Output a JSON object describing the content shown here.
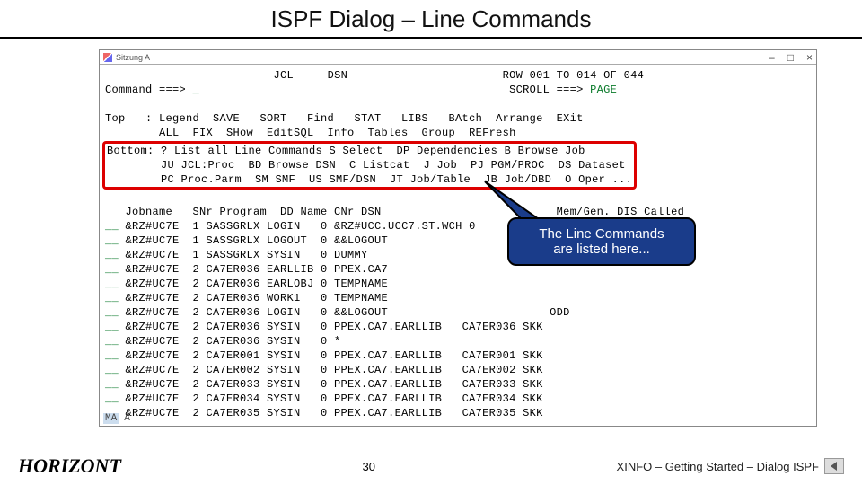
{
  "slide": {
    "title": "ISPF Dialog – Line Commands",
    "brand": "HORIZONT",
    "pagenum": "30",
    "credit": "XINFO – Getting Started – Dialog ISPF"
  },
  "window": {
    "title_label": "Sitzung A",
    "btn_min": "–",
    "btn_max": "□",
    "btn_close": "×"
  },
  "term": {
    "hdr_jcl": "JCL",
    "hdr_dsn": "DSN",
    "row_info": "ROW 001 TO 014 OF 044",
    "scroll_label": "SCROLL ===>",
    "scroll_value": "PAGE",
    "cmd_label": "Command ===>",
    "cmd_cursor": "_",
    "top_line1": "Top   : Legend  SAVE   SORT   Find   STAT   LIBS   BAtch  Arrange  EXit",
    "top_line2": "        ALL  FIX  SHow  EditSQL  Info  Tables  Group  REFresh",
    "bot_line1": "Bottom: ? List all Line Commands S Select  DP Dependencies B Browse Job",
    "bot_line2": "        JU JCL:Proc  BD Browse DSN  C Listcat  J Job  PJ PGM/PROC  DS Dataset",
    "bot_line3": "        PC Proc.Parm  SM SMF  US SMF/DSN  JT Job/Table  JB Job/DBD  O Oper ...",
    "col_header": "   Jobname   SNr Program  DD Name CNr DSN                          Mem/Gen. DIS Called",
    "status_ma": "MA",
    "status_a": "A"
  },
  "rows": [
    {
      "job": "&RZ#UC7E",
      "snr": "1",
      "prog": "SASSGRLX",
      "dd": "LOGIN  ",
      "cnr": "0",
      "dsn": "&RZ#UCC.UCC7.ST.WCH 0           SKK"
    },
    {
      "job": "&RZ#UC7E",
      "snr": "1",
      "prog": "SASSGRLX",
      "dd": "LOGOUT ",
      "cnr": "0",
      "dsn": "&&LOGOUT                        NRR"
    },
    {
      "job": "&RZ#UC7E",
      "snr": "1",
      "prog": "SASSGRLX",
      "dd": "SYSIN  ",
      "cnr": "0",
      "dsn": "DUMMY"
    },
    {
      "job": "&RZ#UC7E",
      "snr": "2",
      "prog": "CA7ER036",
      "dd": "EARLLIB",
      "cnr": "0",
      "dsn": "PPEX.CA7"
    },
    {
      "job": "&RZ#UC7E",
      "snr": "2",
      "prog": "CA7ER036",
      "dd": "EARLOBJ",
      "cnr": "0",
      "dsn": "TEMPNAME"
    },
    {
      "job": "&RZ#UC7E",
      "snr": "2",
      "prog": "CA7ER036",
      "dd": "WORK1  ",
      "cnr": "0",
      "dsn": "TEMPNAME"
    },
    {
      "job": "&RZ#UC7E",
      "snr": "2",
      "prog": "CA7ER036",
      "dd": "LOGIN  ",
      "cnr": "0",
      "dsn": "&&LOGOUT                        ODD"
    },
    {
      "job": "&RZ#UC7E",
      "snr": "2",
      "prog": "CA7ER036",
      "dd": "SYSIN  ",
      "cnr": "0",
      "dsn": "PPEX.CA7.EARLLIB   CA7ER036 SKK"
    },
    {
      "job": "&RZ#UC7E",
      "snr": "2",
      "prog": "CA7ER036",
      "dd": "SYSIN  ",
      "cnr": "0",
      "dsn": "*"
    },
    {
      "job": "&RZ#UC7E",
      "snr": "2",
      "prog": "CA7ER001",
      "dd": "SYSIN  ",
      "cnr": "0",
      "dsn": "PPEX.CA7.EARLLIB   CA7ER001 SKK"
    },
    {
      "job": "&RZ#UC7E",
      "snr": "2",
      "prog": "CA7ER002",
      "dd": "SYSIN  ",
      "cnr": "0",
      "dsn": "PPEX.CA7.EARLLIB   CA7ER002 SKK"
    },
    {
      "job": "&RZ#UC7E",
      "snr": "2",
      "prog": "CA7ER033",
      "dd": "SYSIN  ",
      "cnr": "0",
      "dsn": "PPEX.CA7.EARLLIB   CA7ER033 SKK"
    },
    {
      "job": "&RZ#UC7E",
      "snr": "2",
      "prog": "CA7ER034",
      "dd": "SYSIN  ",
      "cnr": "0",
      "dsn": "PPEX.CA7.EARLLIB   CA7ER034 SKK"
    },
    {
      "job": "&RZ#UC7E",
      "snr": "2",
      "prog": "CA7ER035",
      "dd": "SYSIN  ",
      "cnr": "0",
      "dsn": "PPEX.CA7.EARLLIB   CA7ER035 SKK"
    }
  ],
  "callout": {
    "line1": "The Line Commands",
    "line2": "are listed here..."
  }
}
